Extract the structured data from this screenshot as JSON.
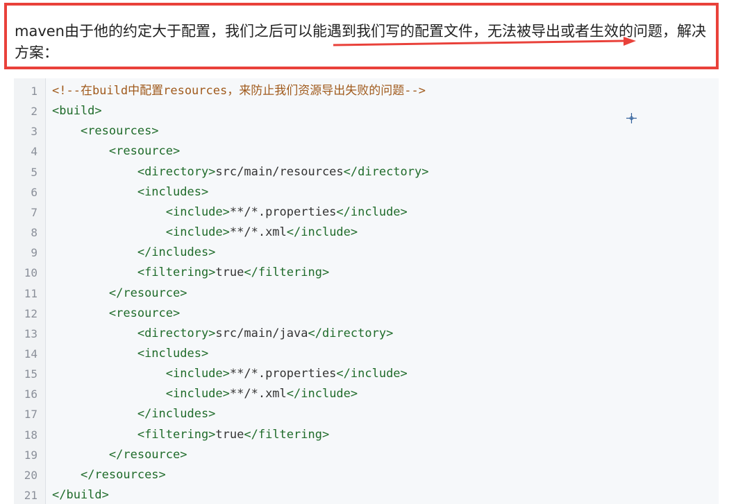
{
  "note": {
    "text": "maven由于他的约定大于配置，我们之后可以能遇到我们写的配置文件，无法被导出或者生效的问题，解决方案："
  },
  "colors": {
    "highlight_border": "#e9413a",
    "tag": "#1f6b2a",
    "comment": "#a05a1c",
    "code_bg": "#f6f8fa"
  },
  "code": {
    "lines": [
      {
        "no": "1",
        "parts": [
          {
            "t": "<!--在build中配置resources，来防止我们资源导出失败的问题-->",
            "c": "cmt"
          }
        ]
      },
      {
        "no": "2",
        "parts": [
          {
            "t": "<build>",
            "c": "tag"
          }
        ]
      },
      {
        "no": "3",
        "parts": [
          {
            "t": "    ",
            "c": "txt"
          },
          {
            "t": "<resources>",
            "c": "tag"
          }
        ]
      },
      {
        "no": "4",
        "parts": [
          {
            "t": "        ",
            "c": "txt"
          },
          {
            "t": "<resource>",
            "c": "tag"
          }
        ]
      },
      {
        "no": "5",
        "parts": [
          {
            "t": "            ",
            "c": "txt"
          },
          {
            "t": "<directory>",
            "c": "tag"
          },
          {
            "t": "src/main/resources",
            "c": "txt"
          },
          {
            "t": "</directory>",
            "c": "tag"
          }
        ]
      },
      {
        "no": "6",
        "parts": [
          {
            "t": "            ",
            "c": "txt"
          },
          {
            "t": "<includes>",
            "c": "tag"
          }
        ]
      },
      {
        "no": "7",
        "parts": [
          {
            "t": "                ",
            "c": "txt"
          },
          {
            "t": "<include>",
            "c": "tag"
          },
          {
            "t": "**/*.properties",
            "c": "txt"
          },
          {
            "t": "</include>",
            "c": "tag"
          }
        ]
      },
      {
        "no": "8",
        "parts": [
          {
            "t": "                ",
            "c": "txt"
          },
          {
            "t": "<include>",
            "c": "tag"
          },
          {
            "t": "**/*.xml",
            "c": "txt"
          },
          {
            "t": "</include>",
            "c": "tag"
          }
        ]
      },
      {
        "no": "9",
        "parts": [
          {
            "t": "            ",
            "c": "txt"
          },
          {
            "t": "</includes>",
            "c": "tag"
          }
        ]
      },
      {
        "no": "10",
        "parts": [
          {
            "t": "            ",
            "c": "txt"
          },
          {
            "t": "<filtering>",
            "c": "tag"
          },
          {
            "t": "true",
            "c": "txt"
          },
          {
            "t": "</filtering>",
            "c": "tag"
          }
        ]
      },
      {
        "no": "11",
        "parts": [
          {
            "t": "        ",
            "c": "txt"
          },
          {
            "t": "</resource>",
            "c": "tag"
          }
        ]
      },
      {
        "no": "12",
        "parts": [
          {
            "t": "        ",
            "c": "txt"
          },
          {
            "t": "<resource>",
            "c": "tag"
          }
        ]
      },
      {
        "no": "13",
        "parts": [
          {
            "t": "            ",
            "c": "txt"
          },
          {
            "t": "<directory>",
            "c": "tag"
          },
          {
            "t": "src/main/java",
            "c": "txt"
          },
          {
            "t": "</directory>",
            "c": "tag"
          }
        ]
      },
      {
        "no": "14",
        "parts": [
          {
            "t": "            ",
            "c": "txt"
          },
          {
            "t": "<includes>",
            "c": "tag"
          }
        ]
      },
      {
        "no": "15",
        "parts": [
          {
            "t": "                ",
            "c": "txt"
          },
          {
            "t": "<include>",
            "c": "tag"
          },
          {
            "t": "**/*.properties",
            "c": "txt"
          },
          {
            "t": "</include>",
            "c": "tag"
          }
        ]
      },
      {
        "no": "16",
        "parts": [
          {
            "t": "                ",
            "c": "txt"
          },
          {
            "t": "<include>",
            "c": "tag"
          },
          {
            "t": "**/*.xml",
            "c": "txt"
          },
          {
            "t": "</include>",
            "c": "tag"
          }
        ]
      },
      {
        "no": "17",
        "parts": [
          {
            "t": "            ",
            "c": "txt"
          },
          {
            "t": "</includes>",
            "c": "tag"
          }
        ]
      },
      {
        "no": "18",
        "parts": [
          {
            "t": "            ",
            "c": "txt"
          },
          {
            "t": "<filtering>",
            "c": "tag"
          },
          {
            "t": "true",
            "c": "txt"
          },
          {
            "t": "</filtering>",
            "c": "tag"
          }
        ]
      },
      {
        "no": "19",
        "parts": [
          {
            "t": "        ",
            "c": "txt"
          },
          {
            "t": "</resource>",
            "c": "tag"
          }
        ]
      },
      {
        "no": "20",
        "parts": [
          {
            "t": "    ",
            "c": "txt"
          },
          {
            "t": "</resources>",
            "c": "tag"
          }
        ]
      },
      {
        "no": "21",
        "parts": [
          {
            "t": "</build>",
            "c": "tag"
          }
        ]
      }
    ]
  }
}
